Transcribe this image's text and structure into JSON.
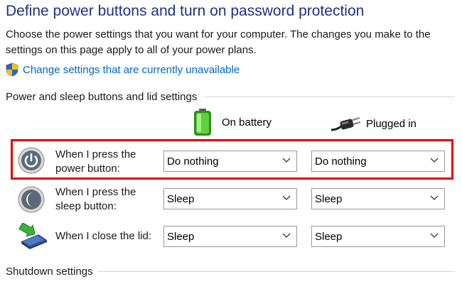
{
  "header": {
    "title": "Define power buttons and turn on password protection",
    "description": "Choose the power settings that you want for your computer. The changes you make to the settings on this page apply to all of your power plans.",
    "change_link": "Change settings that are currently unavailable"
  },
  "buttons_section": {
    "heading": "Power and sleep buttons and lid settings",
    "columns": {
      "battery": "On battery",
      "plugged": "Plugged in"
    },
    "rows": [
      {
        "label": "When I press the power button:",
        "battery": "Do nothing",
        "plugged": "Do nothing",
        "icon": "power-button-icon"
      },
      {
        "label": "When I press the sleep button:",
        "battery": "Sleep",
        "plugged": "Sleep",
        "icon": "sleep-button-icon"
      },
      {
        "label": "When I close the lid:",
        "battery": "Sleep",
        "plugged": "Sleep",
        "icon": "laptop-lid-icon"
      }
    ]
  },
  "shutdown_section": {
    "heading": "Shutdown settings"
  },
  "colors": {
    "title": "#1e3287",
    "link": "#0066cc",
    "highlight": "#e00000"
  }
}
